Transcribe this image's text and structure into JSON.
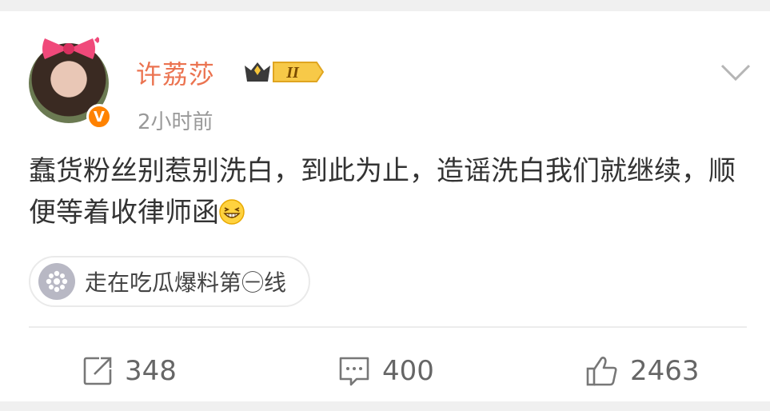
{
  "post": {
    "author": "许荔莎",
    "verified_mark": "V",
    "rank_badge_text": "II",
    "timestamp": "2小时前",
    "text": "蠢货粉丝别惹别洗白，到此为止，造谣洗白我们就继续，顺便等着收律师函",
    "emoji": "grinning-emoji",
    "topic": "走在吃瓜爆料第㊀线"
  },
  "actions": {
    "repost_count": "348",
    "comment_count": "400",
    "like_count": "2463"
  },
  "icons": {
    "more": "chevron-down-icon",
    "repost": "share-icon",
    "comment": "comment-icon",
    "like": "thumbs-up-icon",
    "topic": "topic-icon"
  },
  "colors": {
    "username": "#eb7350",
    "verified": "#ff8200",
    "background": "#f0f0f0",
    "card": "#ffffff"
  }
}
